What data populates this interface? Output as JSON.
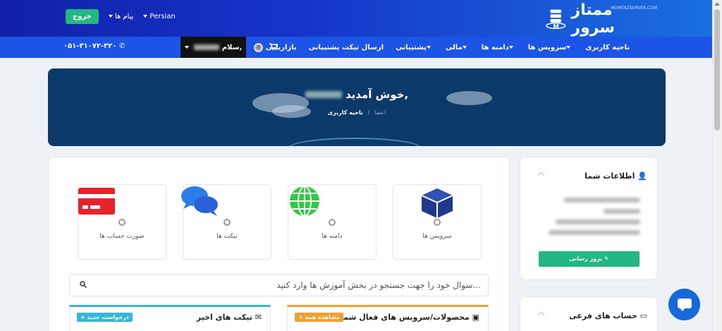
{
  "brand": {
    "logo_text": "ممتاز سرور",
    "logo_sub": "MOMTAZSERVER.COM"
  },
  "top": {
    "language": "Persian",
    "messages": "پیام ها",
    "logout": "خروج"
  },
  "nav": {
    "items": [
      "ناحیه کاربری",
      "سرویس ها",
      "دامنه ها",
      "مالی",
      "پشتیبانی",
      "ارسال تیکت پشتیبانی",
      "بازاریابی"
    ],
    "dropdown": [
      false,
      true,
      true,
      true,
      true,
      false,
      false
    ],
    "cart_count": "0",
    "hello": "سلام,",
    "phone": "۰۵۱-۳۱۰۷۲-۳۲۰"
  },
  "hero": {
    "title": "خوش آمدید,",
    "breadcrumb_current": "اعضا",
    "breadcrumb_home": "ناحیه کاربری"
  },
  "tiles": [
    {
      "label": "سرویس ها",
      "icon": "cube-icon",
      "count": "0"
    },
    {
      "label": "دامنه ها",
      "icon": "globe-icon",
      "count": "0"
    },
    {
      "label": "تیکت ها",
      "icon": "chat-icon",
      "count": "0"
    },
    {
      "label": "صورت حساب ها",
      "icon": "credit-card-icon",
      "count": "0"
    }
  ],
  "search": {
    "placeholder": "سوال خود را جهت جستجو در بخش آموزش ها وارد کنید..."
  },
  "panels": {
    "products": {
      "title": "محصولات/سرویس های فعال شما",
      "button": "+ مشاهده همه"
    },
    "tickets": {
      "title": "تیکت های اخیر",
      "button": "+ درخواست جدید"
    }
  },
  "sidebar": {
    "info_title": "اطلاعات شما",
    "update_button": "بروز رسانی",
    "sub_accounts_title": "حساب های فرعی"
  },
  "colors": {
    "primary": "#1c55e6",
    "green": "#23b883",
    "hero": "#0b3a6a",
    "orange": "#f0a030",
    "cyan": "#38b6d8"
  }
}
